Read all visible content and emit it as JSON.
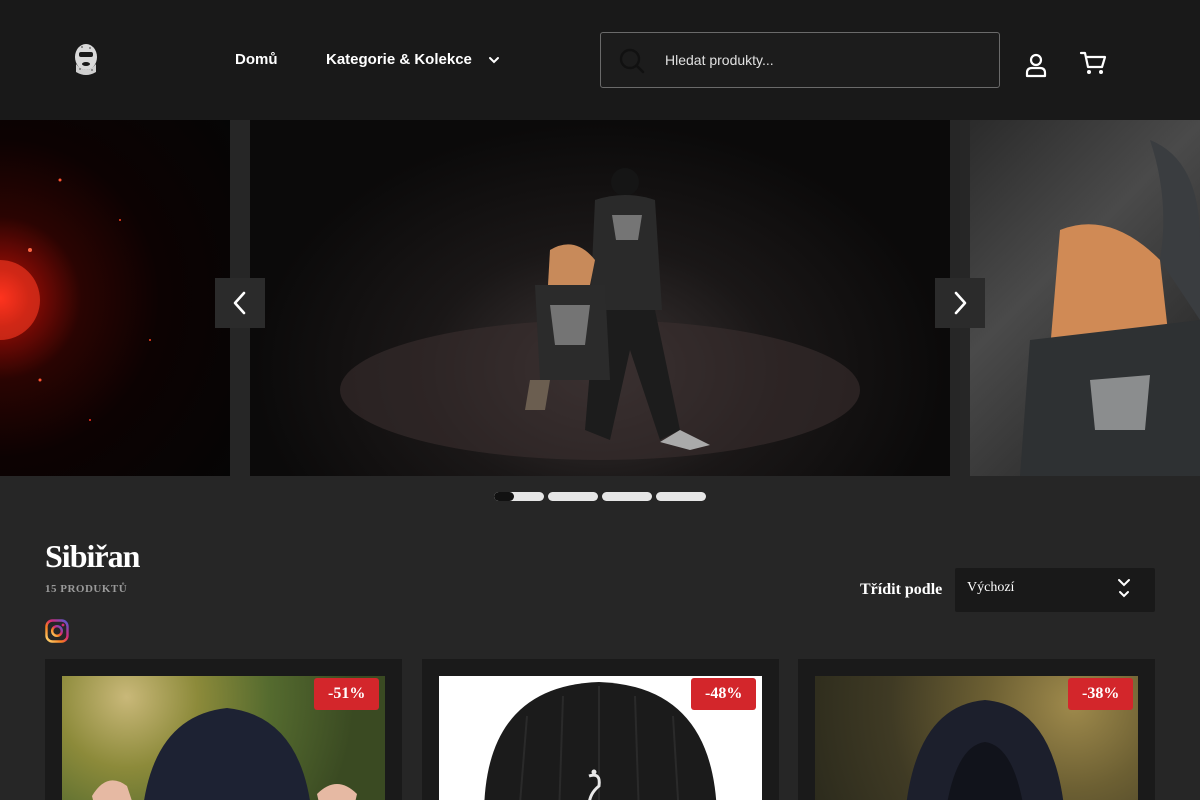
{
  "header": {
    "logo_icon": "balaclava-logo-icon",
    "nav": {
      "home": "Domů",
      "categories": "Kategorie & Kolekce"
    },
    "search": {
      "placeholder": "Hledat produkty...",
      "value": ""
    },
    "icons": [
      "search-icon",
      "user-icon",
      "cart-icon",
      "chevron-down-icon"
    ]
  },
  "slider": {
    "slides_count": 4,
    "active_index": 0,
    "active_progress": 0.4
  },
  "collection": {
    "title": "Sibiřan",
    "count": "15 PRODUKTŮ",
    "social_icon": "instagram-icon"
  },
  "sort": {
    "label": "Třídit podle",
    "selected": "Výchozí"
  },
  "products": [
    {
      "discount": "-51%"
    },
    {
      "discount": "-48%"
    },
    {
      "discount": "-38%"
    }
  ],
  "colors": {
    "header_bg": "#191919",
    "page_bg": "#262626",
    "badge": "#d3262b",
    "instagram": "#e1306c"
  }
}
